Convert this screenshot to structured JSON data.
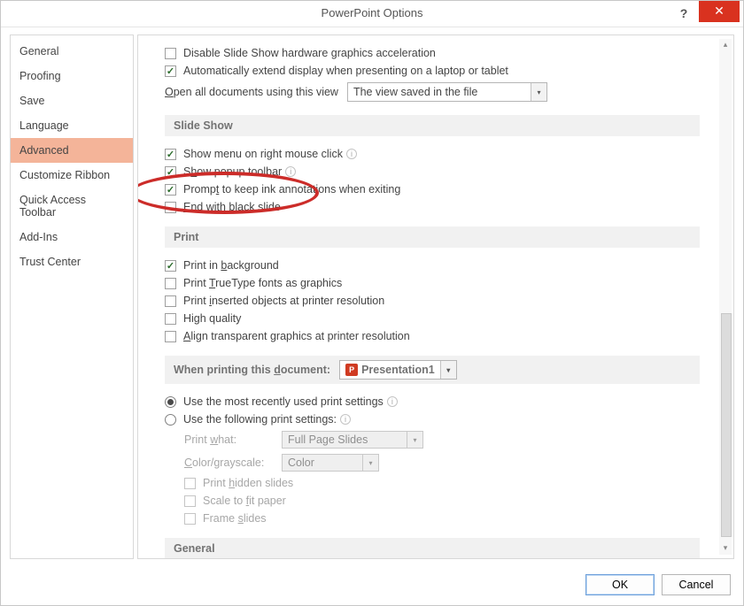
{
  "title": "PowerPoint Options",
  "titlebar": {
    "help_glyph": "?",
    "close_glyph": "✕"
  },
  "sidebar": {
    "items": [
      {
        "label": "General"
      },
      {
        "label": "Proofing"
      },
      {
        "label": "Save"
      },
      {
        "label": "Language"
      },
      {
        "label": "Advanced",
        "selected": true
      },
      {
        "label": "Customize Ribbon"
      },
      {
        "label": "Quick Access Toolbar"
      },
      {
        "label": "Add-Ins"
      },
      {
        "label": "Trust Center"
      }
    ]
  },
  "top_opts": {
    "disable_hw_accel": {
      "label": "Disable Slide Show hardware graphics acceleration",
      "checked": false
    },
    "auto_extend": {
      "label": "Automatically extend display when presenting on a laptop or tablet",
      "checked": true
    },
    "open_view_pre": "O",
    "open_view_rest": "pen all documents using this view",
    "open_view_value": "The view saved in the file"
  },
  "sections": {
    "slideshow": "Slide Show",
    "print": "Print",
    "print_doc_pre": "When printing this ",
    "print_doc_u": "d",
    "print_doc_rest": "ocument:",
    "general": "General"
  },
  "slideshow": {
    "show_menu": {
      "label": "Show menu on right mouse click",
      "checked": true
    },
    "popup_pre": "S",
    "popup_u": "h",
    "popup_rest": "ow popup toolbar",
    "popup_checked": true,
    "prompt_ink_pre": "Promp",
    "prompt_ink_u": "t",
    "prompt_ink_rest": " to keep ink annotations when exiting",
    "prompt_ink_checked": true,
    "end_black_u": "E",
    "end_black_rest": "nd with black slide",
    "end_black_checked": false
  },
  "print": {
    "bg_pre": "Print in ",
    "bg_u": "b",
    "bg_rest": "ackground",
    "bg_checked": true,
    "tt_pre": "Print ",
    "tt_u": "T",
    "tt_rest": "rueType fonts as graphics",
    "tt_checked": false,
    "ins_pre": "Print ",
    "ins_u": "i",
    "ins_rest": "nserted objects at printer resolution",
    "ins_checked": false,
    "hq_label": "High quality",
    "hq_checked": false,
    "align_u": "A",
    "align_rest": "lign transparent graphics at printer resolution",
    "align_checked": false
  },
  "print_doc_value": "Presentation1",
  "print_settings": {
    "recent_label": "Use the most recently used print settings",
    "custom_label": "Use the following print settings:",
    "selected": "recent",
    "print_what_label_pre": "Print ",
    "print_what_u": "w",
    "print_what_rest": "hat:",
    "print_what_value": "Full Page Slides",
    "color_label_u": "C",
    "color_label_rest": "olor/grayscale:",
    "color_value": "Color",
    "hidden_pre": "Print ",
    "hidden_u": "h",
    "hidden_rest": "idden slides",
    "scale_pre": "Scale to ",
    "scale_u": "f",
    "scale_rest": "it paper",
    "frame_pre": "Frame ",
    "frame_u": "s",
    "frame_rest": "lides"
  },
  "footer": {
    "ok": "OK",
    "cancel": "Cancel"
  }
}
